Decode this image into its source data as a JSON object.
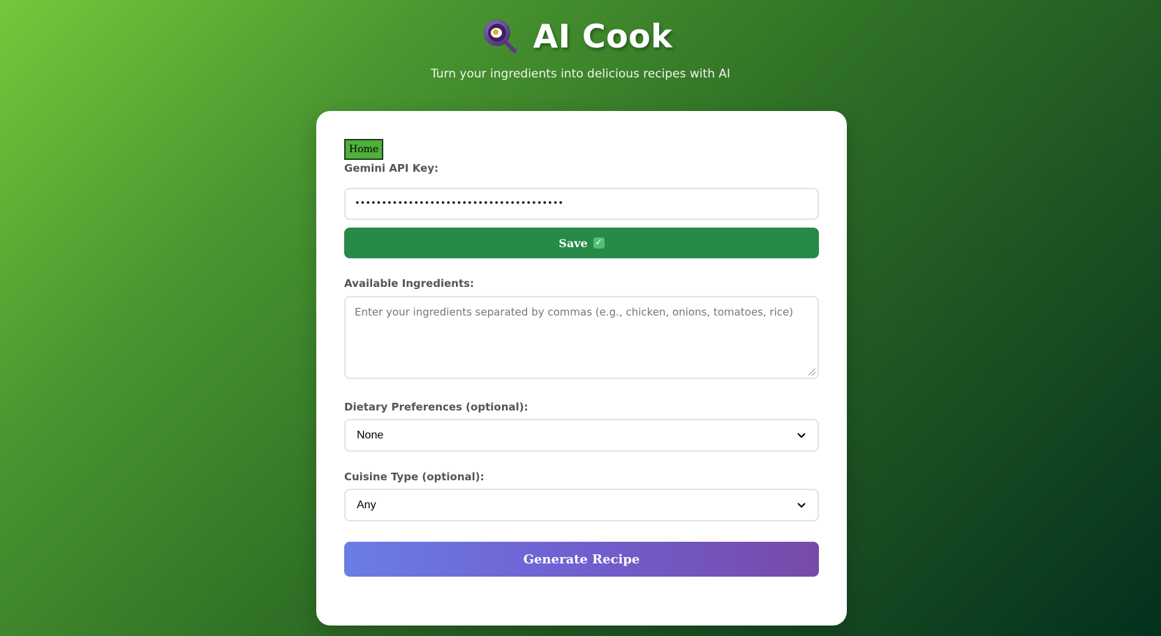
{
  "header": {
    "title": "AI Cook",
    "subtitle": "Turn your ingredients into delicious recipes with AI",
    "logo_icon": "magnifier-egg-pan-icon"
  },
  "nav": {
    "home_label": "Home"
  },
  "api_key": {
    "label": "Gemini API Key:",
    "masked_value": "•••••••••••••••••••••••••••••••••••••••",
    "save_label": "Save",
    "save_icon": "check-box-icon"
  },
  "ingredients": {
    "label": "Available Ingredients:",
    "placeholder": "Enter your ingredients separated by commas (e.g., chicken, onions, tomatoes, rice)"
  },
  "dietary": {
    "label": "Dietary Preferences (optional):",
    "selected": "None"
  },
  "cuisine": {
    "label": "Cuisine Type (optional):",
    "selected": "Any"
  },
  "generate": {
    "label": "Generate Recipe"
  },
  "colors": {
    "background_start": "#74c83a",
    "background_end": "#02311e",
    "save_button": "#278a47",
    "generate_start": "#6a7de6",
    "generate_end": "#774aa8",
    "home_button": "#4fb03c"
  }
}
